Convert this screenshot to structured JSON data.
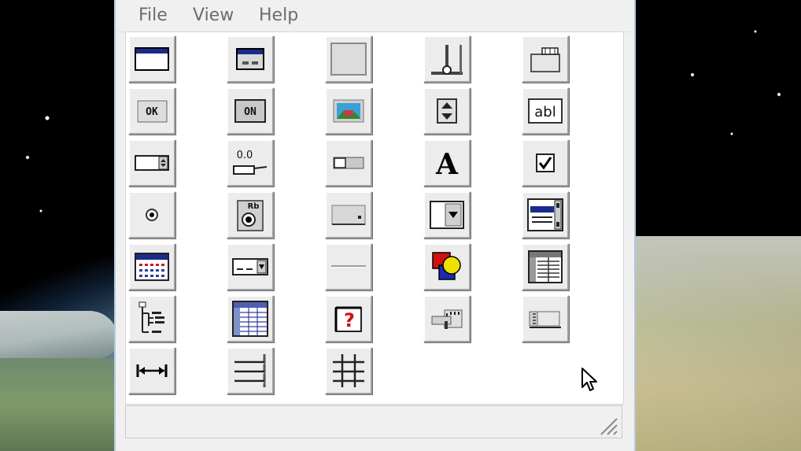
{
  "menu": {
    "file": "File",
    "view": "View",
    "help": "Help"
  },
  "tools": [
    {
      "name": "form-tool-icon"
    },
    {
      "name": "dialog-form-tool-icon"
    },
    {
      "name": "panel-tool-icon"
    },
    {
      "name": "vertical-slider-tool-icon"
    },
    {
      "name": "tab-tool-icon"
    },
    {
      "name": "button-tool-icon",
      "label": "OK"
    },
    {
      "name": "toggle-button-tool-icon",
      "label": "ON"
    },
    {
      "name": "image-tool-icon"
    },
    {
      "name": "spin-button-tool-icon"
    },
    {
      "name": "text-field-tool-icon",
      "label": "abl"
    },
    {
      "name": "spinner-field-tool-icon"
    },
    {
      "name": "progress-tool-icon",
      "label": "0.0"
    },
    {
      "name": "switch-tool-icon"
    },
    {
      "name": "label-tool-icon",
      "label": "A"
    },
    {
      "name": "checkbox-tool-icon"
    },
    {
      "name": "radio-button-tool-icon"
    },
    {
      "name": "radio-group-tool-icon",
      "label": "Rb"
    },
    {
      "name": "status-cell-tool-icon"
    },
    {
      "name": "combo-box-tool-icon"
    },
    {
      "name": "list-box-tool-icon"
    },
    {
      "name": "calendar-tool-icon"
    },
    {
      "name": "date-picker-tool-icon"
    },
    {
      "name": "separator-tool-icon"
    },
    {
      "name": "shapes-tool-icon"
    },
    {
      "name": "table-tool-icon"
    },
    {
      "name": "tree-view-tool-icon"
    },
    {
      "name": "grid-tool-icon"
    },
    {
      "name": "help-tool-icon",
      "label": "?"
    },
    {
      "name": "toolbar-tool-icon"
    },
    {
      "name": "ruler-tool-icon"
    },
    {
      "name": "width-tool-icon"
    },
    {
      "name": "lines-tool-icon"
    },
    {
      "name": "layout-grid-tool-icon"
    }
  ],
  "colors": {
    "window_bg": "#f0f0f0",
    "menu_text": "#6c6c6c",
    "button_face": "#ececec"
  }
}
